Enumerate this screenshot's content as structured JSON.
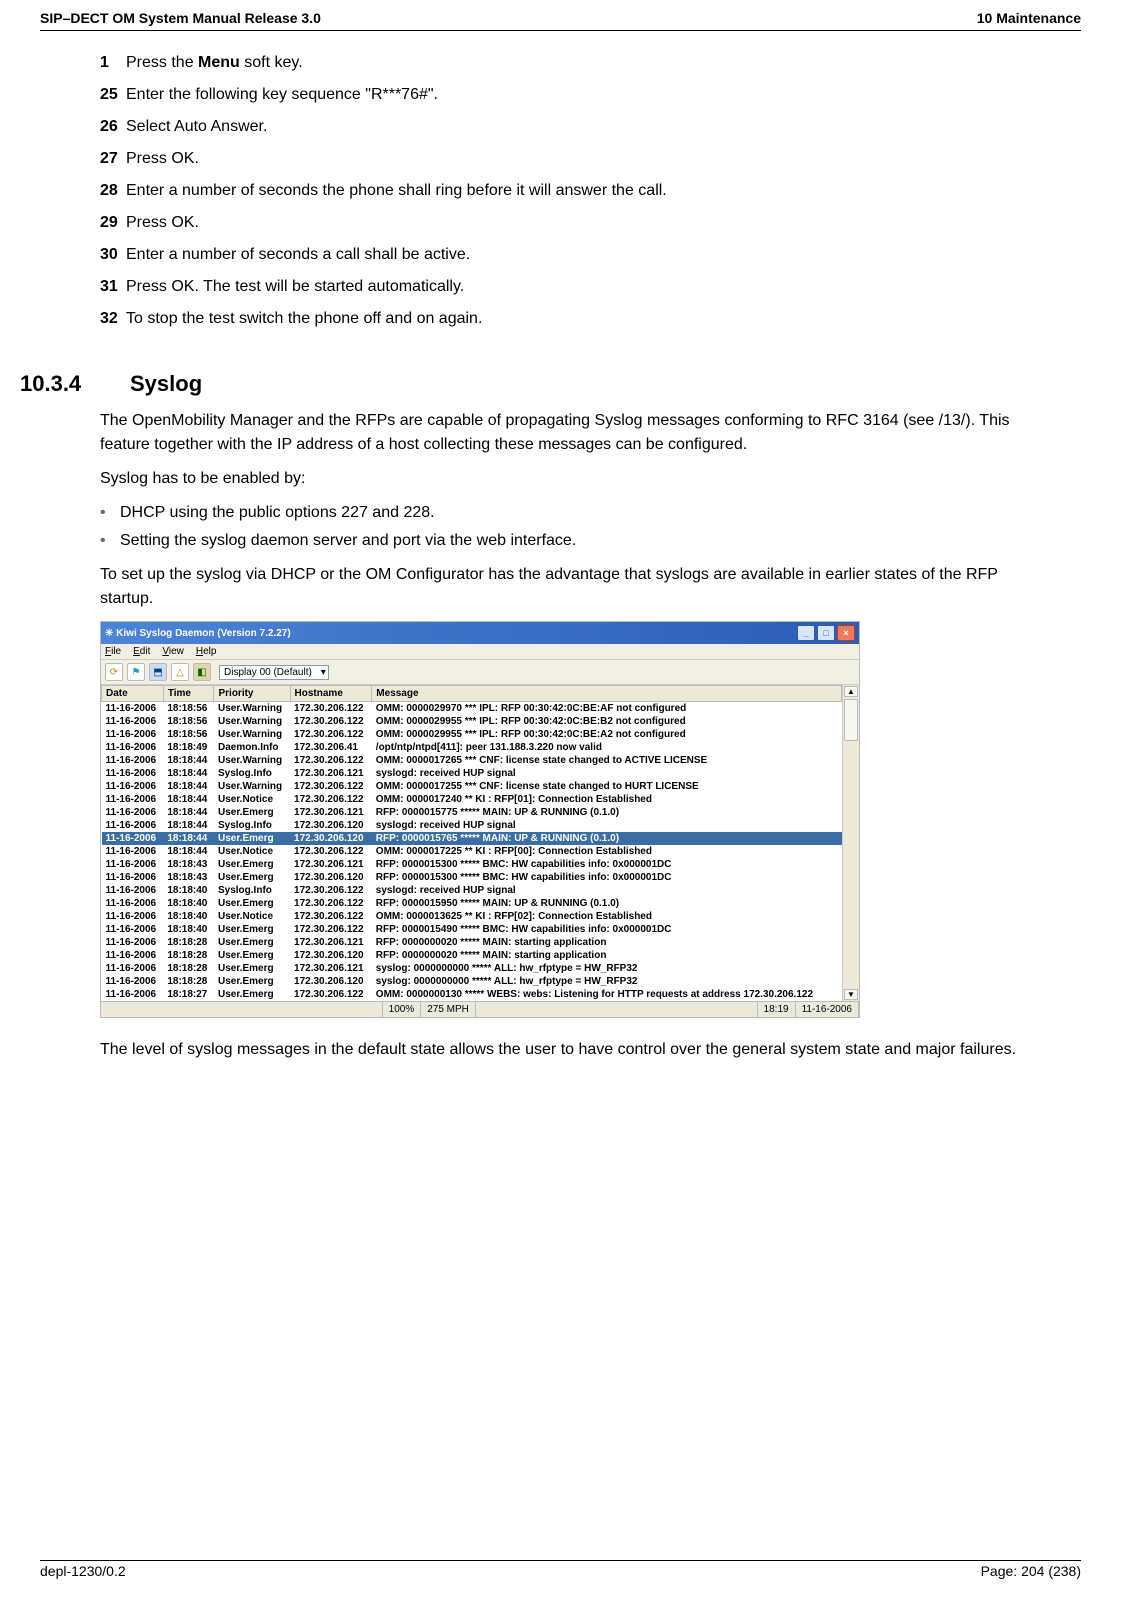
{
  "header": {
    "left": "SIP–DECT OM System Manual Release 3.0",
    "right": "10 Maintenance"
  },
  "steps": [
    {
      "n": "1",
      "t": "Press the Menu soft key.",
      "boldWord": "Menu"
    },
    {
      "n": "25",
      "t": "Enter the following key sequence \"R***76#\"."
    },
    {
      "n": "26",
      "t": "Select Auto Answer."
    },
    {
      "n": "27",
      "t": "Press OK."
    },
    {
      "n": "28",
      "t": "Enter a number of seconds the phone shall ring before it will answer the call."
    },
    {
      "n": "29",
      "t": "Press OK."
    },
    {
      "n": "30",
      "t": "Enter a number of seconds a call shall be active."
    },
    {
      "n": "31",
      "t": "Press OK. The test will be started automatically."
    },
    {
      "n": "32",
      "t": "To stop the test switch the phone off and on again."
    }
  ],
  "section": {
    "num": "10.3.4",
    "title": "Syslog"
  },
  "para1": "The OpenMobility Manager and the RFPs are capable of propagating Syslog messages conforming to RFC 3164 (see /13/). This feature together with the IP address of a host collecting these messages can be configured.",
  "para2": "Syslog has to be enabled by:",
  "bullets": [
    "DHCP using the public options 227 and 228.",
    "Setting the syslog daemon server and port via the web interface."
  ],
  "para3": "To set up the syslog via DHCP or the OM Configurator has the advantage that syslogs are available in earlier states of the RFP startup.",
  "para4": "The level of syslog messages in the default state allows the user to have control over the general system state and major failures.",
  "footer": {
    "left": "depl-1230/0.2",
    "right": "Page: 204 (238)"
  },
  "kiwi": {
    "title": "Kiwi Syslog Daemon (Version 7.2.27)",
    "menus": [
      "File",
      "Edit",
      "View",
      "Help"
    ],
    "display": "Display 00 (Default)",
    "cols": [
      "Date",
      "Time",
      "Priority",
      "Hostname",
      "Message"
    ],
    "rows": [
      [
        "11-16-2006",
        "18:18:56",
        "User.Warning",
        "172.30.206.122",
        "OMM: 0000029970 ***   IPL:  RFP 00:30:42:0C:BE:AF not configured"
      ],
      [
        "11-16-2006",
        "18:18:56",
        "User.Warning",
        "172.30.206.122",
        "OMM: 0000029955 ***   IPL:  RFP 00:30:42:0C:BE:B2 not configured"
      ],
      [
        "11-16-2006",
        "18:18:56",
        "User.Warning",
        "172.30.206.122",
        "OMM: 0000029955 ***   IPL:  RFP 00:30:42:0C:BE:A2 not configured"
      ],
      [
        "11-16-2006",
        "18:18:49",
        "Daemon.Info",
        "172.30.206.41",
        "/opt/ntp/ntpd[411]: peer 131.188.3.220 now valid"
      ],
      [
        "11-16-2006",
        "18:18:44",
        "User.Warning",
        "172.30.206.122",
        "OMM: 0000017265 ***   CNF:  license state changed to ACTIVE LICENSE"
      ],
      [
        "11-16-2006",
        "18:18:44",
        "Syslog.Info",
        "172.30.206.121",
        "syslogd: received HUP signal"
      ],
      [
        "11-16-2006",
        "18:18:44",
        "User.Warning",
        "172.30.206.122",
        "OMM: 0000017255 ***   CNF:  license state changed to HURT LICENSE"
      ],
      [
        "11-16-2006",
        "18:18:44",
        "User.Notice",
        "172.30.206.122",
        "OMM: 0000017240 **    KI :  RFP[01]: Connection Established"
      ],
      [
        "11-16-2006",
        "18:18:44",
        "User.Emerg",
        "172.30.206.121",
        "RFP: 0000015775 ***** MAIN: UP & RUNNING (0.1.0)"
      ],
      [
        "11-16-2006",
        "18:18:44",
        "Syslog.Info",
        "172.30.206.120",
        "syslogd: received HUP signal"
      ],
      [
        "11-16-2006",
        "18:18:44",
        "User.Emerg",
        "172.30.206.120",
        "RFP: 0000015765 ***** MAIN: UP & RUNNING (0.1.0)"
      ],
      [
        "11-16-2006",
        "18:18:44",
        "User.Notice",
        "172.30.206.122",
        "OMM: 0000017225 **    KI :  RFP[00]: Connection Established"
      ],
      [
        "11-16-2006",
        "18:18:43",
        "User.Emerg",
        "172.30.206.121",
        "RFP: 0000015300 ***** BMC:   HW capabilities info: 0x000001DC"
      ],
      [
        "11-16-2006",
        "18:18:43",
        "User.Emerg",
        "172.30.206.120",
        "RFP: 0000015300 ***** BMC:   HW capabilities info: 0x000001DC"
      ],
      [
        "11-16-2006",
        "18:18:40",
        "Syslog.Info",
        "172.30.206.122",
        "syslogd: received HUP signal"
      ],
      [
        "11-16-2006",
        "18:18:40",
        "User.Emerg",
        "172.30.206.122",
        "RFP: 0000015950 ***** MAIN: UP & RUNNING (0.1.0)"
      ],
      [
        "11-16-2006",
        "18:18:40",
        "User.Notice",
        "172.30.206.122",
        "OMM: 0000013625 **    KI :  RFP[02]: Connection Established"
      ],
      [
        "11-16-2006",
        "18:18:40",
        "User.Emerg",
        "172.30.206.122",
        "RFP: 0000015490 ***** BMC:   HW capabilities info: 0x000001DC"
      ],
      [
        "11-16-2006",
        "18:18:28",
        "User.Emerg",
        "172.30.206.121",
        "RFP: 0000000020 ***** MAIN:  starting application"
      ],
      [
        "11-16-2006",
        "18:18:28",
        "User.Emerg",
        "172.30.206.120",
        "RFP: 0000000020 ***** MAIN:  starting application"
      ],
      [
        "11-16-2006",
        "18:18:28",
        "User.Emerg",
        "172.30.206.121",
        "syslog: 0000000000 ***** ALL: hw_rfptype = HW_RFP32"
      ],
      [
        "11-16-2006",
        "18:18:28",
        "User.Emerg",
        "172.30.206.120",
        "syslog: 0000000000 ***** ALL: hw_rfptype = HW_RFP32"
      ],
      [
        "11-16-2006",
        "18:18:27",
        "User.Emerg",
        "172.30.206.122",
        "OMM: 0000000130 ***** WEBS: webs: Listening for HTTP requests at address 172.30.206.122"
      ]
    ],
    "selectedRow": 10,
    "status": {
      "zoom": "100%",
      "mph": "275 MPH",
      "time": "18:19",
      "date": "11-16-2006"
    }
  }
}
